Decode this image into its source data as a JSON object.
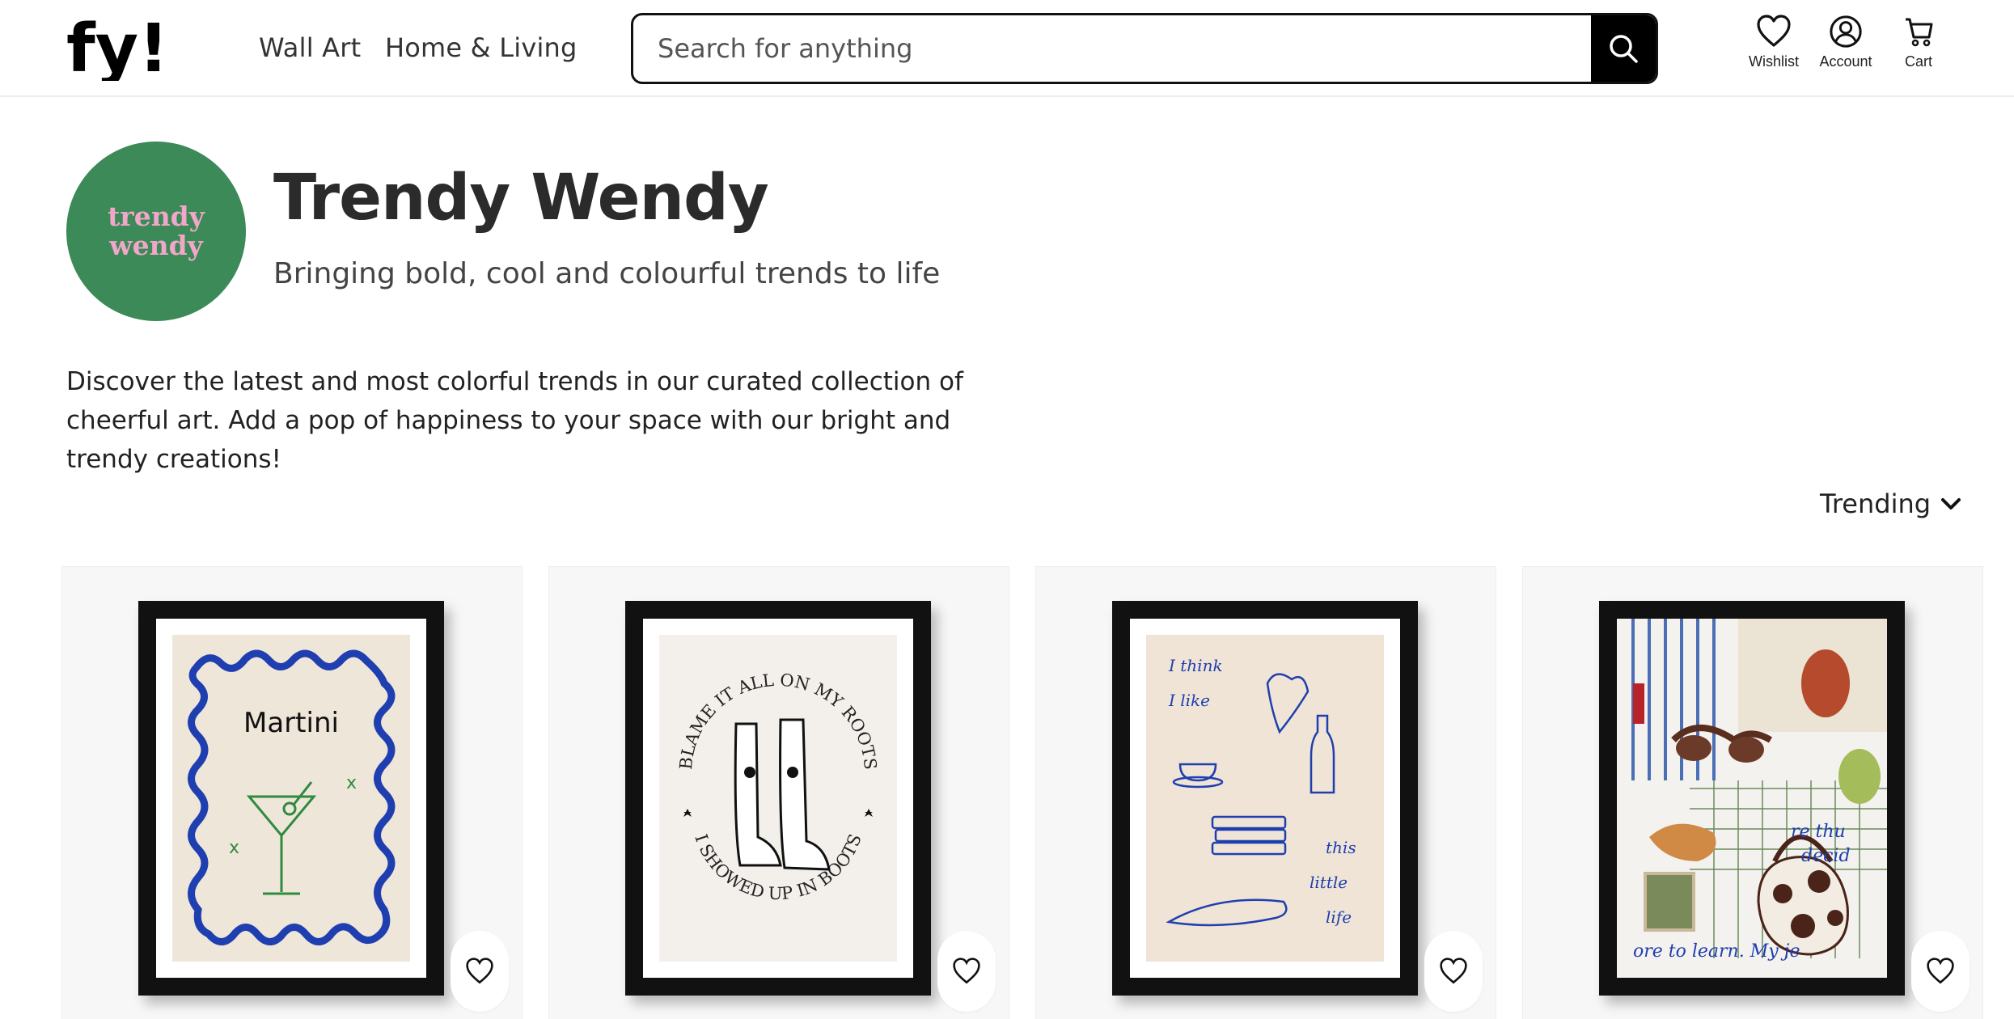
{
  "header": {
    "logo_text": "fy!",
    "nav": [
      "Wall Art",
      "Home & Living"
    ],
    "search": {
      "placeholder": "Search for anything"
    },
    "icons": [
      {
        "label": "Wishlist",
        "icon": "heart-icon"
      },
      {
        "label": "Account",
        "icon": "user-circle-icon"
      },
      {
        "label": "Cart",
        "icon": "cart-icon"
      }
    ]
  },
  "profile": {
    "avatar_line1": "trendy",
    "avatar_line2": "wendy",
    "name": "Trendy Wendy",
    "tagline": "Bringing bold, cool and colourful trends to life",
    "description": "Discover the latest and most colorful trends in our curated collection of cheerful art. Add a pop of happiness to your space with our bright and trendy creations!"
  },
  "sort": {
    "label": "Trending",
    "icon": "chevron-down-icon"
  },
  "products": [
    {
      "art_text": "Martini",
      "favorite_icon": "heart-icon"
    },
    {
      "art_text_top": "BLAME IT ALL ON MY ROOTS",
      "art_text_bottom": "I SHOWED UP IN BOOTS",
      "favorite_icon": "heart-icon"
    },
    {
      "art_text": [
        "I think",
        "I like",
        "this",
        "little",
        "life"
      ],
      "favorite_icon": "heart-icon"
    },
    {
      "art_text": [
        "re thu",
        "decid",
        "ore to learn. My je"
      ],
      "favorite_icon": "heart-icon"
    }
  ],
  "colors": {
    "avatar_bg": "#3b8a57",
    "avatar_text": "#f2a6c9",
    "accent_blue": "#1f3fb0",
    "frame": "#111111"
  }
}
